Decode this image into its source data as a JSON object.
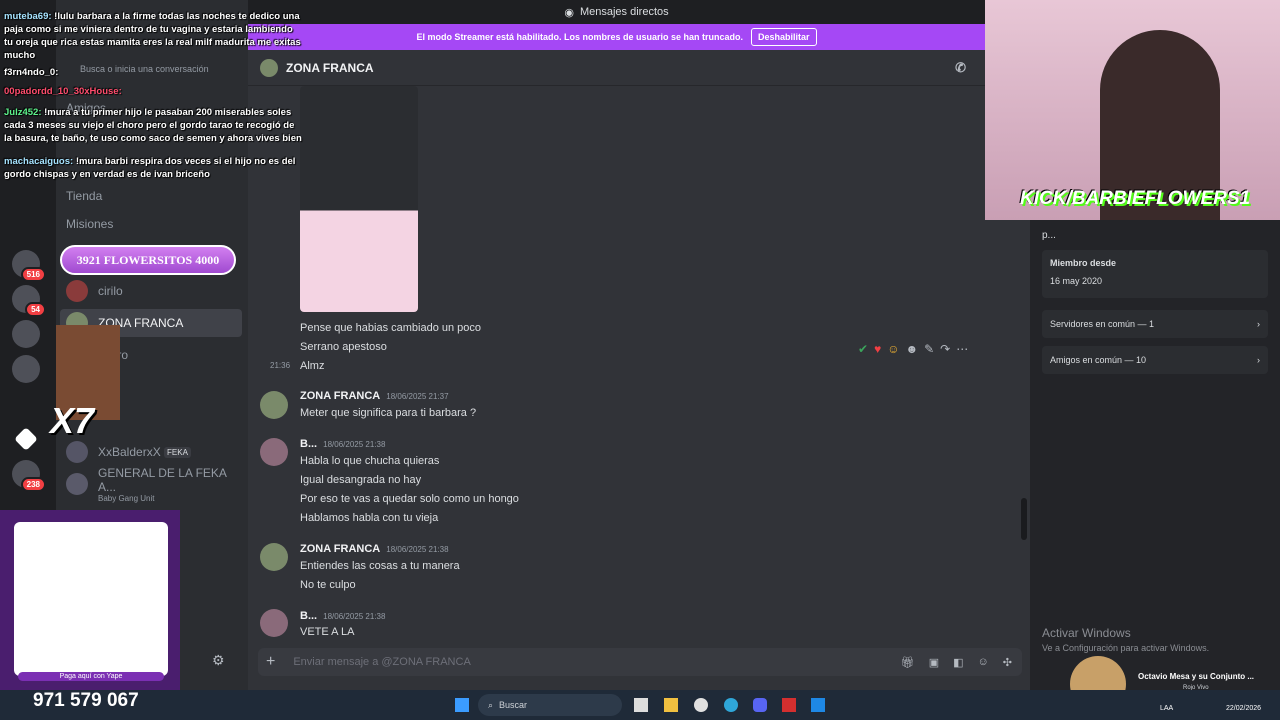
{
  "app": {
    "top_title": "Mensajes directos",
    "streamer_banner": "El modo Streamer está habilitado. Los nombres de usuario se han truncado.",
    "streamer_button": "Deshabilitar",
    "channel_name": "ZONA FRANCA",
    "search_placeholder": "Busca o inicia una conversación"
  },
  "server_rail": {
    "badges": [
      "381",
      "174",
      "516",
      "54",
      "238"
    ]
  },
  "sidebar": {
    "flowers_banner": "3921 FLOWERSITOS 4000",
    "items": [
      {
        "label": "Amigos"
      },
      {
        "label": "Tienda"
      },
      {
        "label": "Misiones"
      },
      {
        "label": "cirilo"
      },
      {
        "label": "ZONA FRANCA"
      },
      {
        "label": "chero"
      },
      {
        "label": "n"
      },
      {
        "label": "XxBalderxX",
        "tag": "FEKA"
      },
      {
        "label": "GENERAL DE LA FEKA A...",
        "sub": "Baby Gang Unit"
      }
    ]
  },
  "messages": [
    {
      "text": "Pense que habias cambiado un poco"
    },
    {
      "text": "Serrano apestoso"
    },
    {
      "time": "21:36",
      "text": "Almz"
    },
    {
      "author": "ZONA FRANCA",
      "time": "18/06/2025 21:37",
      "lines": [
        "Meter que significa para ti barbara ?"
      ]
    },
    {
      "author": "B...",
      "time": "18/06/2025 21:38",
      "lines": [
        "Habla lo que chucha quieras",
        "Igual desangrada no hay",
        "Por eso te vas a quedar solo como un hongo",
        "Hablamos habla con tu vieja"
      ]
    },
    {
      "author": "ZONA FRANCA",
      "time": "18/06/2025 21:38",
      "lines": [
        "Entiendes las cosas a tu manera",
        "No te culpo"
      ]
    },
    {
      "author": "B...",
      "time": "18/06/2025 21:38",
      "lines": [
        "VETE A LA"
      ]
    }
  ],
  "composer": {
    "placeholder": "Enviar mensaje a @ZONA FRANCA"
  },
  "right_panel": {
    "name_trunc": "p...",
    "member_since_label": "Miembro desde",
    "member_since": "16 may 2020",
    "servers_common": "Servidores en común — 1",
    "friends_common": "Amigos en común — 10",
    "activate_title": "Activar Windows",
    "activate_sub": "Ve a Configuración para activar Windows."
  },
  "stream_overlay": {
    "chat": [
      {
        "user": "muteba69:",
        "text": "!lulu barbara a la firme todas las noches te dedico una paja como si me viniera dentro de tu vagina y estaria lambiendo tu oreja que rica estas mamita eres la real milf madurita me exitas mucho"
      },
      {
        "user": "f3rn4ndo_0:",
        "text": ""
      },
      {
        "user": "00padordd_10_30xHouse:",
        "text": ""
      },
      {
        "user": "Julz452:",
        "text": "!mura a tu primer hijo le pasaban 200 miserables soles cada 3 meses su viejo el choro pero el gordo tarao te recogió de la basura, te baño, te uso como saco de semen y ahora vives bien"
      },
      {
        "user": "machacaiguos:",
        "text": "!mura barbi respira dos veces si el hijo no es del gordo chispas y en verdad es de ivan briceño"
      }
    ],
    "kick_handle": "KICK/BARBIEFLOWERS1",
    "x7": "X7",
    "qr_caption": "Paga aquí con Yape",
    "phone": "971 579 067"
  },
  "media": {
    "title": "Octavio Mesa y su Conjunto ...",
    "subtitle": "Rojo Vivo"
  },
  "taskbar": {
    "search": "Buscar",
    "lang": "LAA",
    "date": "22/02/2026"
  }
}
